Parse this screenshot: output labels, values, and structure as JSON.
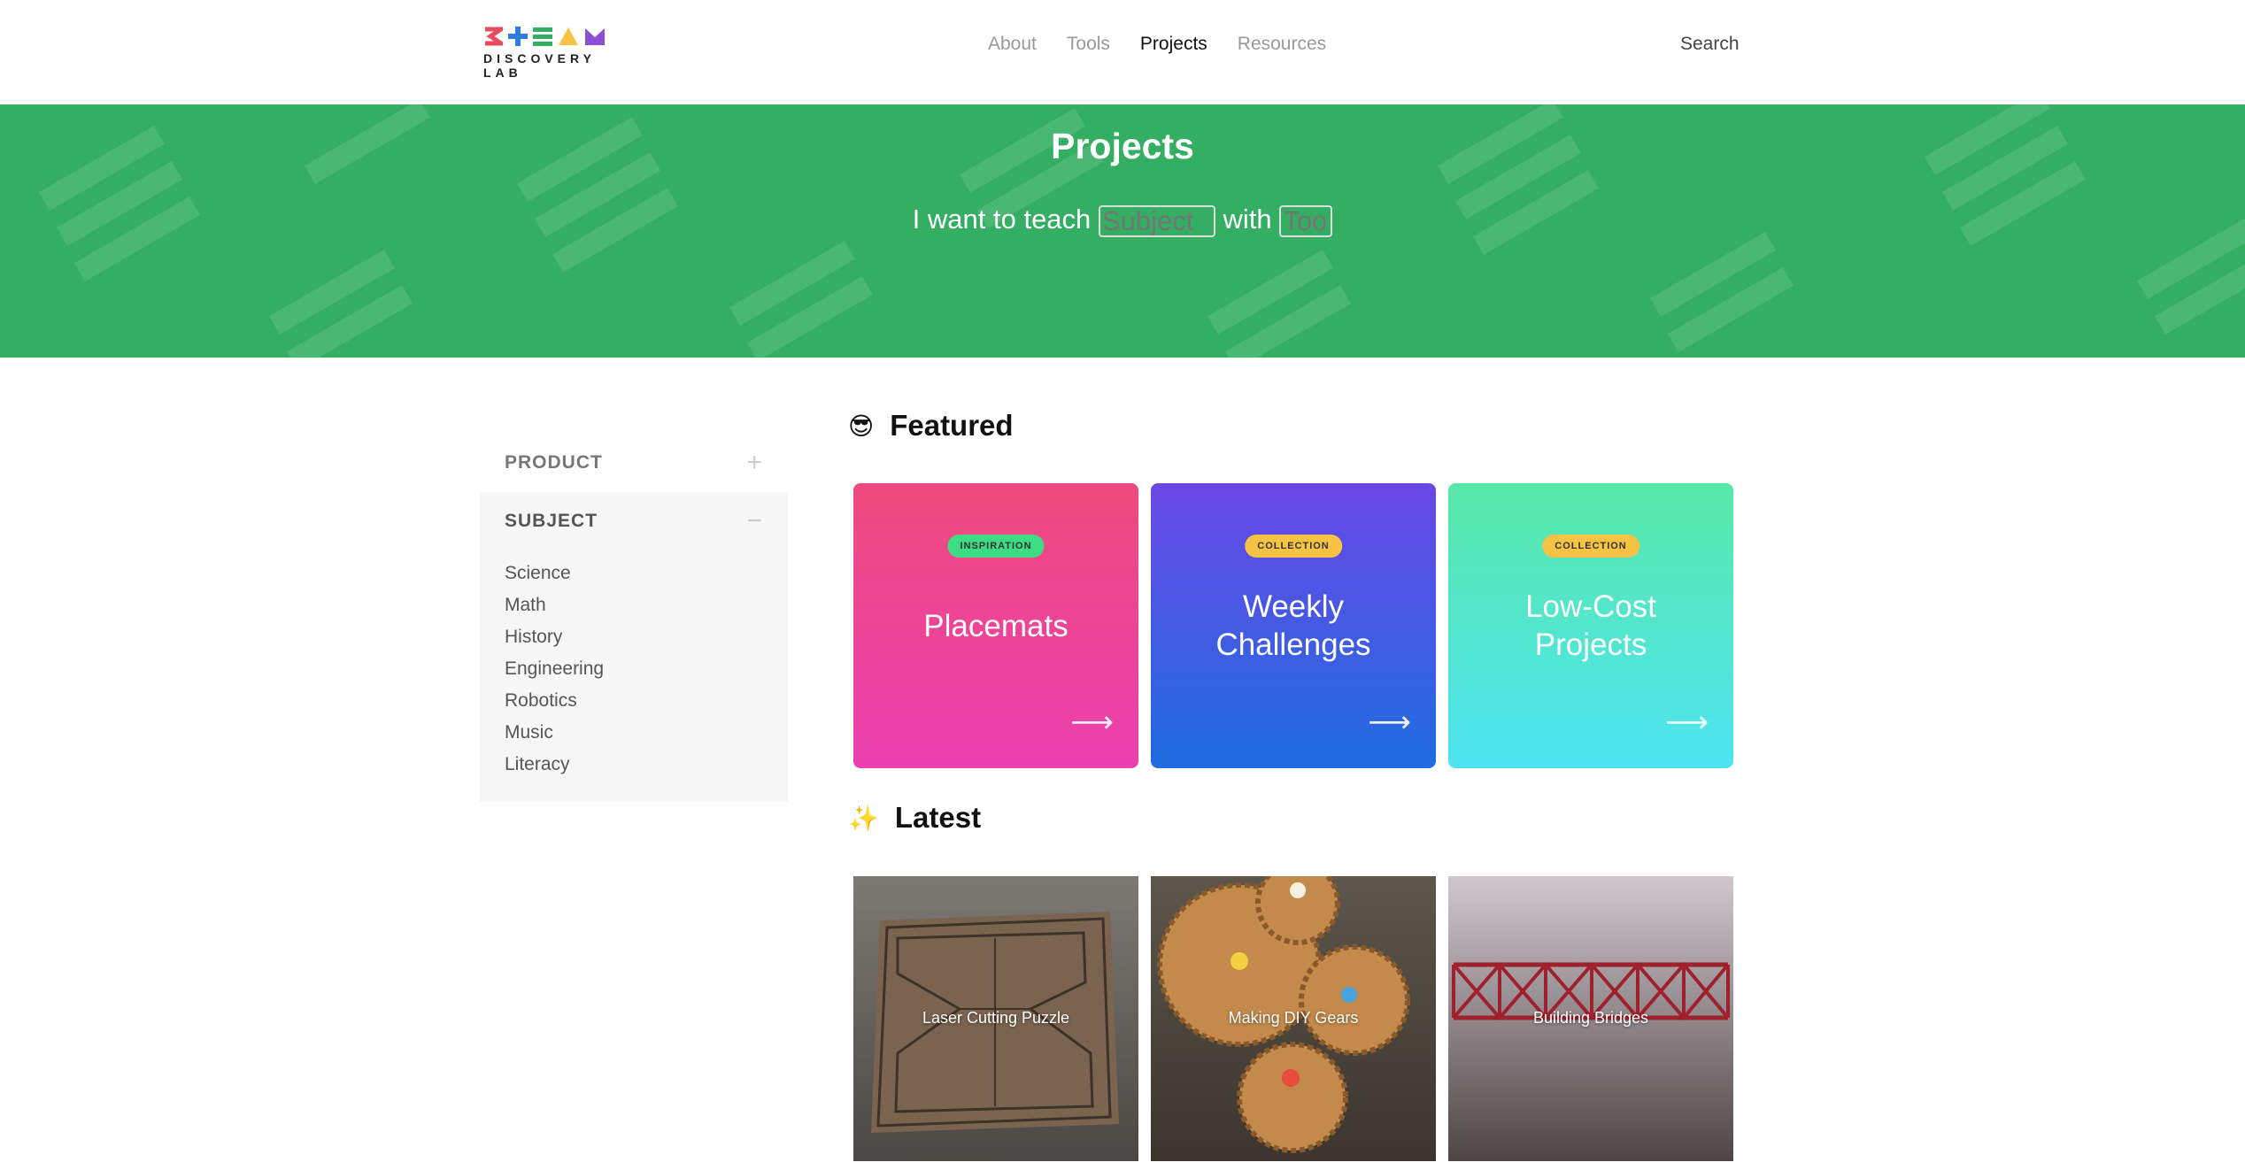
{
  "header": {
    "logo_text": "DISCOVERY LAB",
    "logo_letters": [
      "S",
      "+",
      "E",
      "A",
      "M"
    ],
    "nav": [
      "About",
      "Tools",
      "Projects",
      "Resources"
    ],
    "active_nav": "Projects",
    "search_label": "Search"
  },
  "hero": {
    "title": "Projects",
    "sentence_start": "I want to teach",
    "subject_placeholder": "Subject",
    "sentence_mid": "with",
    "tool_placeholder": "Tool",
    "background_color": "#33ae62"
  },
  "sidebar": {
    "filters": [
      {
        "label": "PRODUCT",
        "toggle": "+"
      },
      {
        "label": "SUBJECT",
        "toggle": "−"
      }
    ],
    "subjects": [
      "Science",
      "Math",
      "History",
      "Engineering",
      "Robotics",
      "Music",
      "Literacy"
    ]
  },
  "featured": {
    "heading": "Featured",
    "emoji": "😎",
    "cards": [
      {
        "badge": "INSPIRATION",
        "title": "Placemats",
        "badge_color": "#3ddc84"
      },
      {
        "badge": "COLLECTION",
        "title": "Weekly Challenges",
        "badge_color": "#f6c344"
      },
      {
        "badge": "COLLECTION",
        "title": "Low-Cost Projects",
        "badge_color": "#f6c344"
      }
    ],
    "arrow": "⟶"
  },
  "latest": {
    "heading": "Latest",
    "emoji": "✨",
    "items": [
      {
        "caption": "Laser Cutting Puzzle"
      },
      {
        "caption": "Making DIY Gears"
      },
      {
        "caption": "Building Bridges"
      }
    ]
  }
}
